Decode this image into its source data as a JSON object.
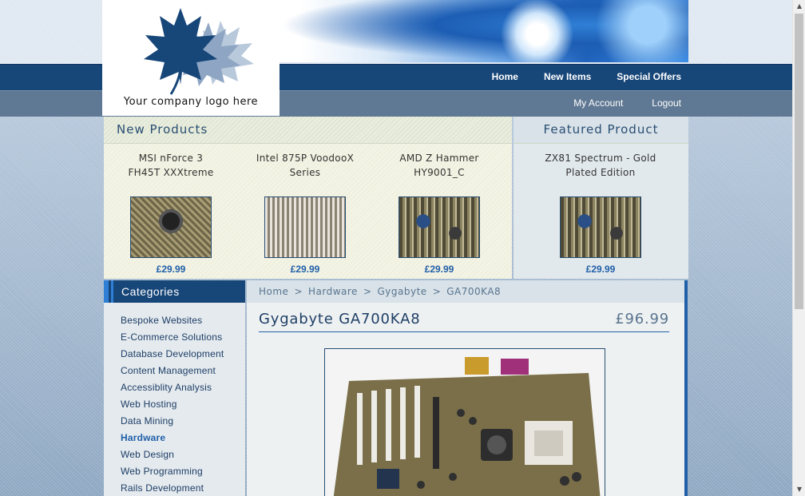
{
  "logo": {
    "text": "Your company logo here"
  },
  "nav": {
    "top": [
      "Home",
      "New Items",
      "Special Offers"
    ],
    "sub": [
      "My Account",
      "Logout"
    ]
  },
  "new_products": {
    "heading": "New Products",
    "items": [
      {
        "name_line1": "MSI nForce 3",
        "name_line2": "FH45T XXXtreme",
        "price": "£29.99"
      },
      {
        "name_line1": "Intel 875P VoodooX",
        "name_line2": "Series",
        "price": "£29.99"
      },
      {
        "name_line1": "AMD Z Hammer",
        "name_line2": "HY9001_C",
        "price": "£29.99"
      }
    ]
  },
  "featured": {
    "heading": "Featured Product",
    "name_line1": "ZX81 Spectrum - Gold",
    "name_line2": "Plated Edition",
    "price": "£29.99"
  },
  "categories": {
    "heading": "Categories",
    "items": [
      "Bespoke Websites",
      "E-Commerce Solutions",
      "Database Development",
      "Content Management",
      "Accessiblity Analysis",
      "Web Hosting",
      "Data Mining",
      "Hardware",
      "Web Design",
      "Web Programming",
      "Rails Development"
    ],
    "active": "Hardware"
  },
  "breadcrumb": [
    "Home",
    "Hardware",
    "Gygabyte",
    "GA700KA8"
  ],
  "product": {
    "title": "Gygabyte GA700KA8",
    "price": "£96.99"
  },
  "colors": {
    "nav_dark": "#174679",
    "nav_grey": "#5f7893",
    "accent": "#2160a9"
  }
}
